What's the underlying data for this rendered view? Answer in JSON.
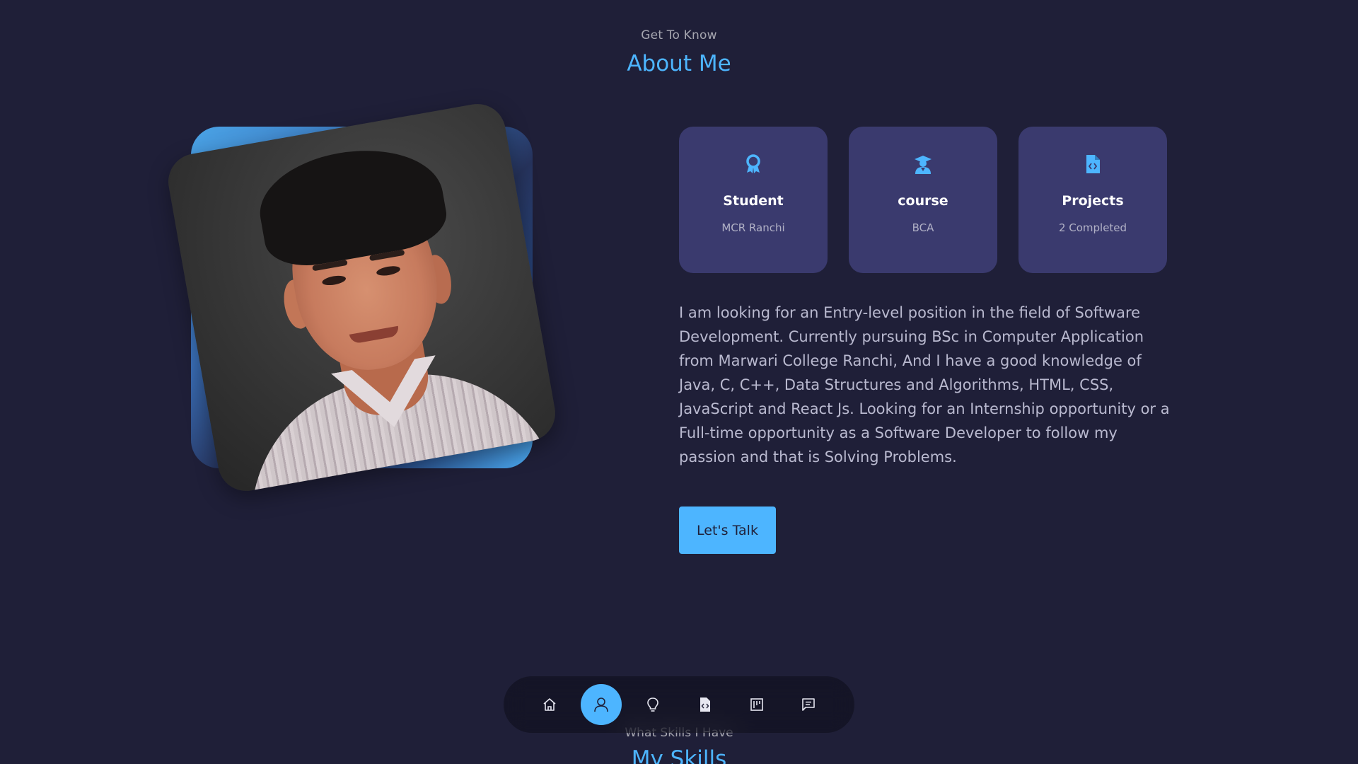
{
  "colors": {
    "background": "#1f1f38",
    "accent": "#4db5ff",
    "card": "#3a3a6e",
    "text_light": "#b9b9cf"
  },
  "about": {
    "subtitle": "Get To Know",
    "title": "About Me",
    "photo_icon": "profile-photo",
    "cards": [
      {
        "icon": "award-icon",
        "title": "Student",
        "subtitle": "MCR Ranchi"
      },
      {
        "icon": "graduate-icon",
        "title": "course",
        "subtitle": "BCA"
      },
      {
        "icon": "file-code-icon",
        "title": "Projects",
        "subtitle": "2 Completed"
      }
    ],
    "description": "I am looking for an Entry-level position in the field of Software Development. Currently pursuing BSc in Computer Application from Marwari College Ranchi, And I have a good knowledge of Java, C, C++, Data Structures and Algorithms, HTML, CSS, JavaScript and React Js. Looking for an Internship opportunity or a Full-time opportunity as a Software Developer to follow my passion and that is Solving Problems.",
    "cta_label": "Let's Talk"
  },
  "next_section": {
    "subtitle": "What Skills I Have",
    "title": "My Skills"
  },
  "nav": {
    "items": [
      {
        "icon": "home-icon",
        "active": false
      },
      {
        "icon": "user-icon",
        "active": true
      },
      {
        "icon": "lightbulb-icon",
        "active": false
      },
      {
        "icon": "file-code-icon",
        "active": false
      },
      {
        "icon": "portfolio-icon",
        "active": false
      },
      {
        "icon": "message-icon",
        "active": false
      }
    ]
  }
}
